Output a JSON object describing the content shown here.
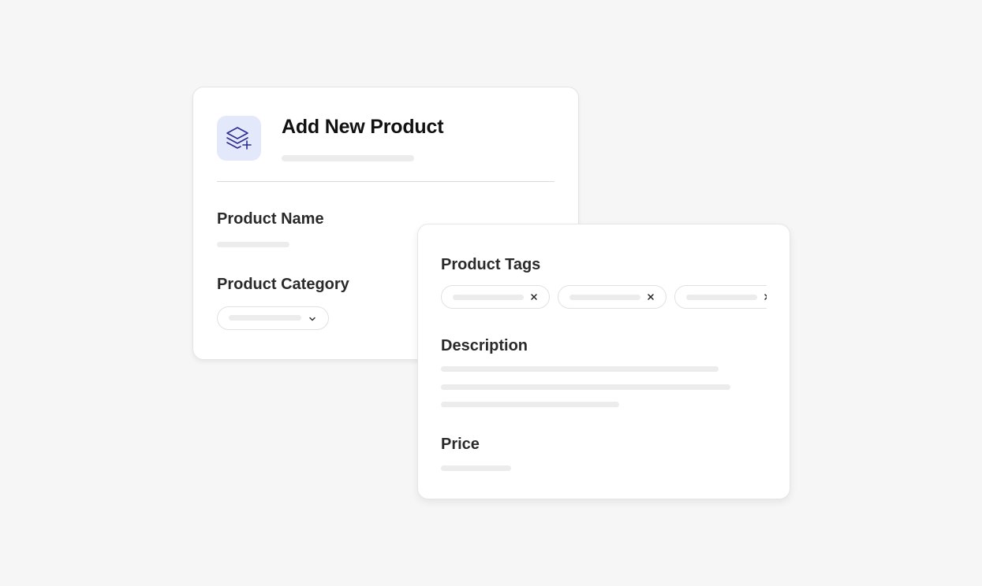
{
  "main_card": {
    "title": "Add New Product",
    "icon": "layers-plus-icon",
    "icon_color": "#2b2d8f",
    "icon_tile_color": "#e3e8fb",
    "fields": {
      "product_name_label": "Product Name",
      "product_category_label": "Product Category"
    }
  },
  "details_card": {
    "fields": {
      "product_tags_label": "Product Tags",
      "description_label": "Description",
      "price_label": "Price"
    },
    "tags_count": 3,
    "tag_remove_icon": "close-icon"
  },
  "colors": {
    "background": "#f6f6f6",
    "card": "#ffffff",
    "placeholder": "#ececec",
    "text": "#2a2a2a"
  }
}
